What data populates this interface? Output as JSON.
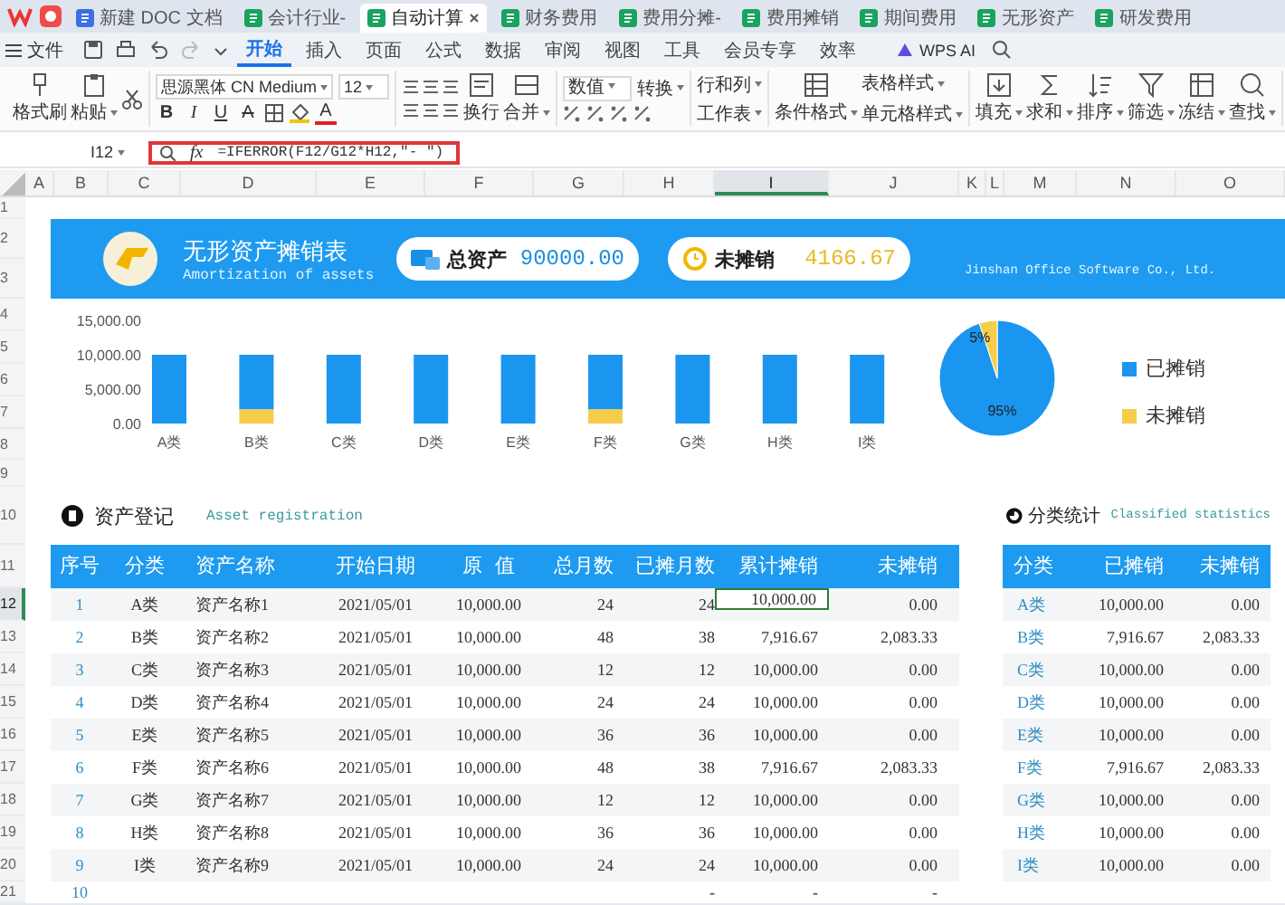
{
  "title_tabs": [
    {
      "label": "新建 DOC 文档",
      "kind": "doc",
      "selected": false
    },
    {
      "label": "会计行业-",
      "kind": "sheet",
      "selected": false
    },
    {
      "label": "自动计算",
      "kind": "sheet",
      "selected": true
    },
    {
      "label": "财务费用",
      "kind": "sheet",
      "selected": false
    },
    {
      "label": "费用分摊-",
      "kind": "sheet",
      "selected": false
    },
    {
      "label": "费用摊销",
      "kind": "sheet",
      "selected": false
    },
    {
      "label": "期间费用",
      "kind": "sheet",
      "selected": false
    },
    {
      "label": "无形资产",
      "kind": "sheet",
      "selected": false
    },
    {
      "label": "研发费用",
      "kind": "sheet",
      "selected": false
    }
  ],
  "menu": {
    "file": "文件",
    "tabs": [
      {
        "label": "开始",
        "selected": true
      },
      {
        "label": "插入",
        "selected": false
      },
      {
        "label": "页面",
        "selected": false
      },
      {
        "label": "公式",
        "selected": false
      },
      {
        "label": "数据",
        "selected": false
      },
      {
        "label": "审阅",
        "selected": false
      },
      {
        "label": "视图",
        "selected": false
      },
      {
        "label": "工具",
        "selected": false
      },
      {
        "label": "会员专享",
        "selected": false
      },
      {
        "label": "效率",
        "selected": false
      }
    ],
    "ai": "WPS AI"
  },
  "ribbon": {
    "clipboard": [
      "格式刷",
      "粘贴"
    ],
    "font_name": "思源黑体 CN Medium",
    "font_size": "12",
    "format_buttons": [
      {
        "label": "B",
        "kind": "bold"
      },
      {
        "label": "I",
        "kind": "italic"
      },
      {
        "label": "U",
        "kind": "underline"
      },
      {
        "label": "A",
        "kind": "strike"
      }
    ],
    "font_color": "A",
    "align_buttons": [
      "换行",
      "合并"
    ],
    "number_format": "数值",
    "convert": "转换",
    "cells": [
      "行和列",
      "工作表"
    ],
    "styles": [
      "条件格式",
      "表格样式",
      "单元格样式"
    ],
    "tools": [
      "填充",
      "求和",
      "排序",
      "筛选",
      "冻结",
      "查找"
    ]
  },
  "formula_bar": {
    "cell": "I12",
    "fx": "fx",
    "formula": "=IFERROR(F12/G12*H12,\"- \")"
  },
  "columns": [
    {
      "label": "A",
      "selected": false
    },
    {
      "label": "B",
      "selected": false
    },
    {
      "label": "C",
      "selected": false
    },
    {
      "label": "D",
      "selected": false
    },
    {
      "label": "E",
      "selected": false
    },
    {
      "label": "F",
      "selected": false
    },
    {
      "label": "G",
      "selected": false
    },
    {
      "label": "H",
      "selected": false
    },
    {
      "label": "I",
      "selected": true
    },
    {
      "label": "J",
      "selected": false
    },
    {
      "label": "K",
      "selected": false
    },
    {
      "label": "L",
      "selected": false
    },
    {
      "label": "M",
      "selected": false
    },
    {
      "label": "N",
      "selected": false
    },
    {
      "label": "O",
      "selected": false
    }
  ],
  "rows": [
    {
      "label": "1",
      "selected": false
    },
    {
      "label": "2",
      "selected": false
    },
    {
      "label": "3",
      "selected": false
    },
    {
      "label": "4",
      "selected": false
    },
    {
      "label": "5",
      "selected": false
    },
    {
      "label": "6",
      "selected": false
    },
    {
      "label": "7",
      "selected": false
    },
    {
      "label": "8",
      "selected": false
    },
    {
      "label": "9",
      "selected": false
    },
    {
      "label": "10",
      "selected": false
    },
    {
      "label": "11",
      "selected": false
    },
    {
      "label": "12",
      "selected": true
    },
    {
      "label": "13",
      "selected": false
    },
    {
      "label": "14",
      "selected": false
    },
    {
      "label": "15",
      "selected": false
    },
    {
      "label": "16",
      "selected": false
    },
    {
      "label": "17",
      "selected": false
    },
    {
      "label": "18",
      "selected": false
    },
    {
      "label": "19",
      "selected": false
    },
    {
      "label": "20",
      "selected": false
    },
    {
      "label": "21",
      "selected": false
    }
  ],
  "banner": {
    "title": "无形资产摊销表",
    "subtitle": "Amortization of assets",
    "stats": [
      {
        "label": "总资产",
        "value": "90000.00",
        "kind": "total"
      },
      {
        "label": "未摊销",
        "value": "4166.67",
        "kind": "remaining"
      }
    ],
    "company": "Jinshan Office Software Co., Ltd."
  },
  "bar_chart": {
    "chart_data": {
      "type": "bar",
      "categories": [
        "A类",
        "B类",
        "C类",
        "D类",
        "E类",
        "F类",
        "G类",
        "H类",
        "I类"
      ],
      "stacked": true,
      "ylim": [
        0,
        15000
      ],
      "yticks": [
        {
          "value": 0,
          "label": "0.00"
        },
        {
          "value": 5000,
          "label": "5,000.00"
        },
        {
          "value": 10000,
          "label": "10,000.00"
        },
        {
          "value": 15000,
          "label": "15,000.00"
        }
      ],
      "series": [
        {
          "name": "未摊销",
          "color": "#f5cd4b",
          "values": [
            0,
            2083.33,
            0,
            0,
            0,
            2083.33,
            0,
            0,
            0
          ]
        },
        {
          "name": "已摊销",
          "color": "#1a96f0",
          "values": [
            10000,
            7916.67,
            10000,
            10000,
            10000,
            7916.67,
            10000,
            10000,
            10000
          ]
        }
      ]
    }
  },
  "pie_chart": {
    "chart_data": {
      "type": "pie",
      "values": [
        95,
        5
      ],
      "colors": [
        "#1a96f0",
        "#f5cd4b"
      ],
      "value_labels": [
        "95%",
        "5%"
      ]
    }
  },
  "asset_register": {
    "title": "资产登记",
    "subtitle": "Asset registration",
    "columns": [
      "序号",
      "分类",
      "资产名称",
      "开始日期",
      "原  值",
      "总月数",
      "已摊月数",
      "累计摊销",
      "未摊销"
    ],
    "rows": [
      {
        "cells": [
          "1",
          "A类",
          "资产名称1",
          "2021/05/01",
          "10,000.00",
          "24",
          "24",
          "10,000.00",
          "0.00"
        ],
        "selected": true
      },
      {
        "cells": [
          "2",
          "B类",
          "资产名称2",
          "2021/05/01",
          "10,000.00",
          "48",
          "38",
          "7,916.67",
          "2,083.33"
        ],
        "selected": false
      },
      {
        "cells": [
          "3",
          "C类",
          "资产名称3",
          "2021/05/01",
          "10,000.00",
          "12",
          "12",
          "10,000.00",
          "0.00"
        ],
        "selected": false
      },
      {
        "cells": [
          "4",
          "D类",
          "资产名称4",
          "2021/05/01",
          "10,000.00",
          "24",
          "24",
          "10,000.00",
          "0.00"
        ],
        "selected": false
      },
      {
        "cells": [
          "5",
          "E类",
          "资产名称5",
          "2021/05/01",
          "10,000.00",
          "36",
          "36",
          "10,000.00",
          "0.00"
        ],
        "selected": false
      },
      {
        "cells": [
          "6",
          "F类",
          "资产名称6",
          "2021/05/01",
          "10,000.00",
          "48",
          "38",
          "7,916.67",
          "2,083.33"
        ],
        "selected": false
      },
      {
        "cells": [
          "7",
          "G类",
          "资产名称7",
          "2021/05/01",
          "10,000.00",
          "12",
          "12",
          "10,000.00",
          "0.00"
        ],
        "selected": false
      },
      {
        "cells": [
          "8",
          "H类",
          "资产名称8",
          "2021/05/01",
          "10,000.00",
          "36",
          "36",
          "10,000.00",
          "0.00"
        ],
        "selected": false
      },
      {
        "cells": [
          "9",
          "I类",
          "资产名称9",
          "2021/05/01",
          "10,000.00",
          "24",
          "24",
          "10,000.00",
          "0.00"
        ],
        "selected": false
      },
      {
        "cells": [
          "10",
          null,
          null,
          null,
          null,
          null,
          "-",
          "-",
          "-"
        ],
        "selected": false
      }
    ]
  },
  "category_stats": {
    "title": "分类统计",
    "subtitle": "Classified statistics",
    "columns": [
      "分类",
      "已摊销",
      "未摊销"
    ],
    "rows": [
      [
        "A类",
        "10,000.00",
        "0.00"
      ],
      [
        "B类",
        "7,916.67",
        "2,083.33"
      ],
      [
        "C类",
        "10,000.00",
        "0.00"
      ],
      [
        "D类",
        "10,000.00",
        "0.00"
      ],
      [
        "E类",
        "10,000.00",
        "0.00"
      ],
      [
        "F类",
        "7,916.67",
        "2,083.33"
      ],
      [
        "G类",
        "10,000.00",
        "0.00"
      ],
      [
        "H类",
        "10,000.00",
        "0.00"
      ],
      [
        "I类",
        "10,000.00",
        "0.00"
      ]
    ]
  }
}
